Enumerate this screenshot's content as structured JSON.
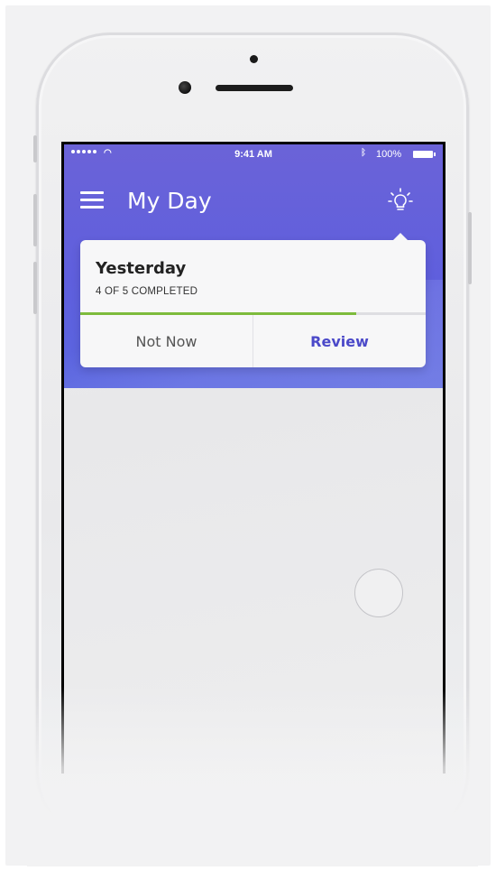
{
  "status_bar": {
    "carrier_dots": 5,
    "time": "9:41 AM",
    "battery_percent": "100%",
    "battery_level": 1.0
  },
  "header": {
    "menu_icon": "hamburger-menu-icon",
    "title": "My Day",
    "suggestions_icon": "lightbulb-icon"
  },
  "card": {
    "title": "Yesterday",
    "subtitle": "4 OF 5 COMPLETED",
    "progress": 0.8,
    "progress_color": "#7dbb3c",
    "actions": {
      "dismiss_label": "Not Now",
      "review_label": "Review"
    }
  },
  "colors": {
    "header_gradient_top": "#6b63d8",
    "header_gradient_bottom": "#5a66e0",
    "accent": "#4b49c9"
  },
  "fab_icon": "add-circle-icon"
}
